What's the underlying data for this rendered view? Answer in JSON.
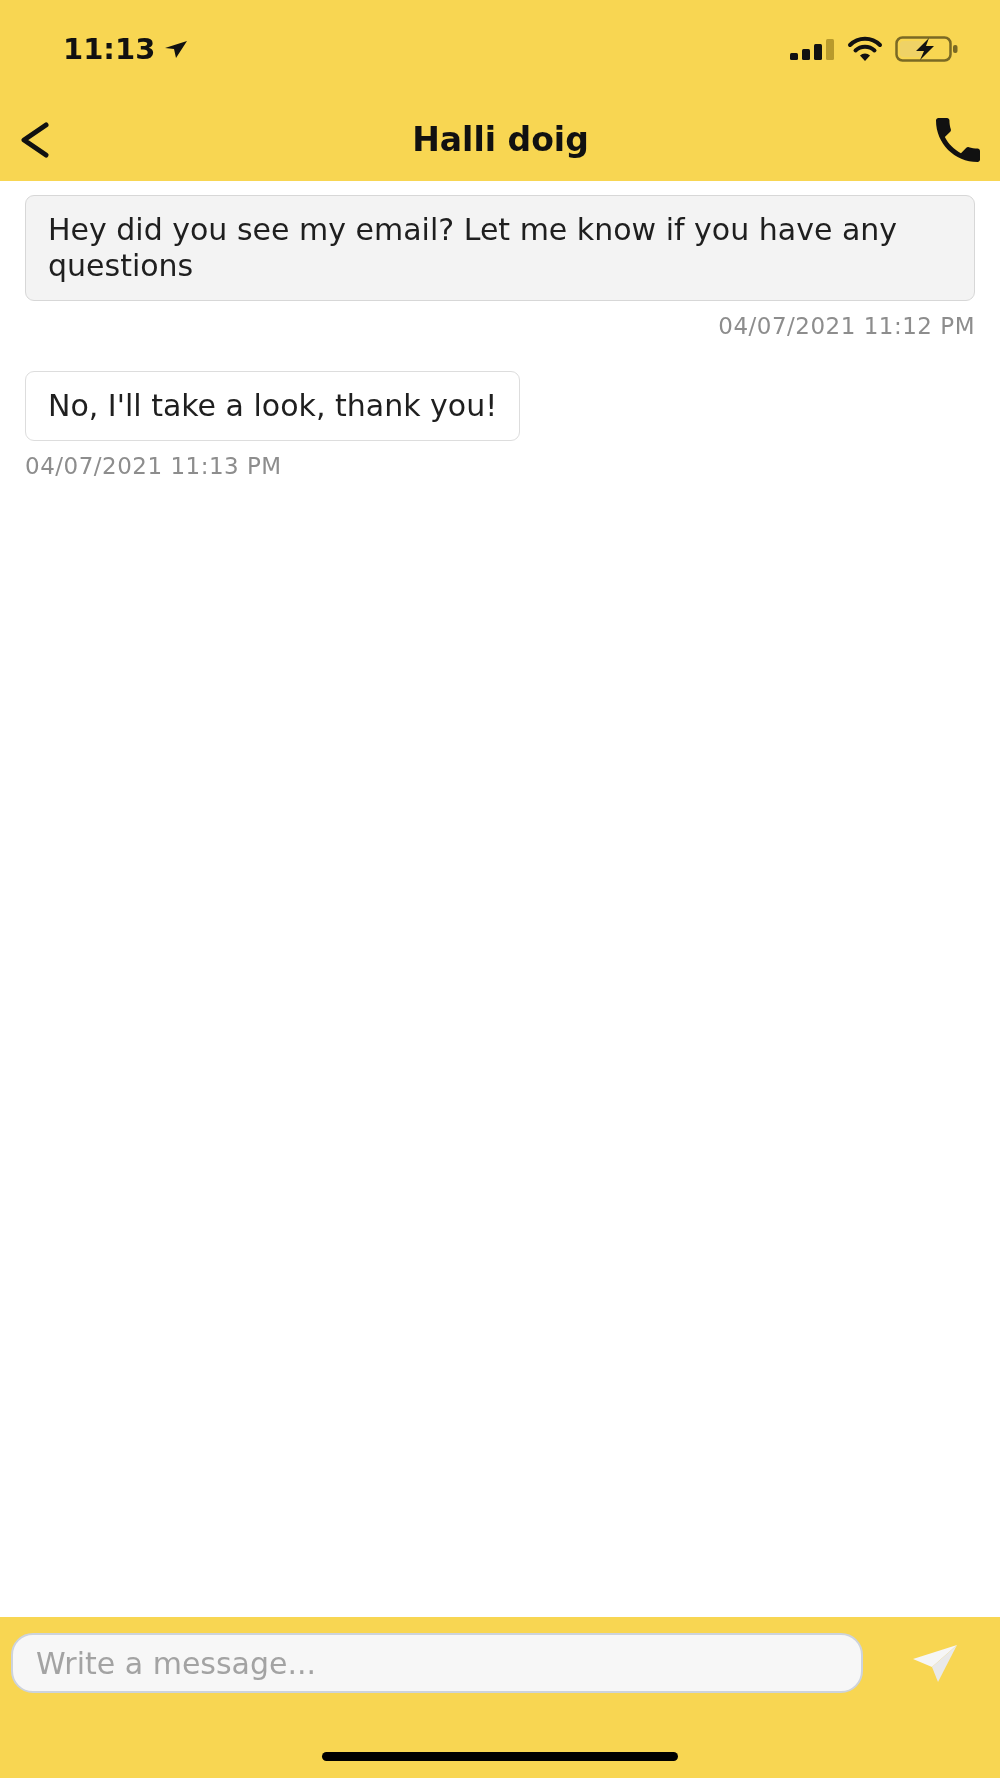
{
  "status_bar": {
    "time": "11:13"
  },
  "header": {
    "title": "Halli doig"
  },
  "messages": [
    {
      "kind": "outgoing",
      "text": "Hey did you see my email? Let me know if you have any questions",
      "timestamp": "04/07/2021 11:12 PM"
    },
    {
      "kind": "incoming",
      "text": "No, I'll take a look, thank you!",
      "timestamp": "04/07/2021 11:13 PM"
    }
  ],
  "composer": {
    "placeholder": "Write a message..."
  }
}
